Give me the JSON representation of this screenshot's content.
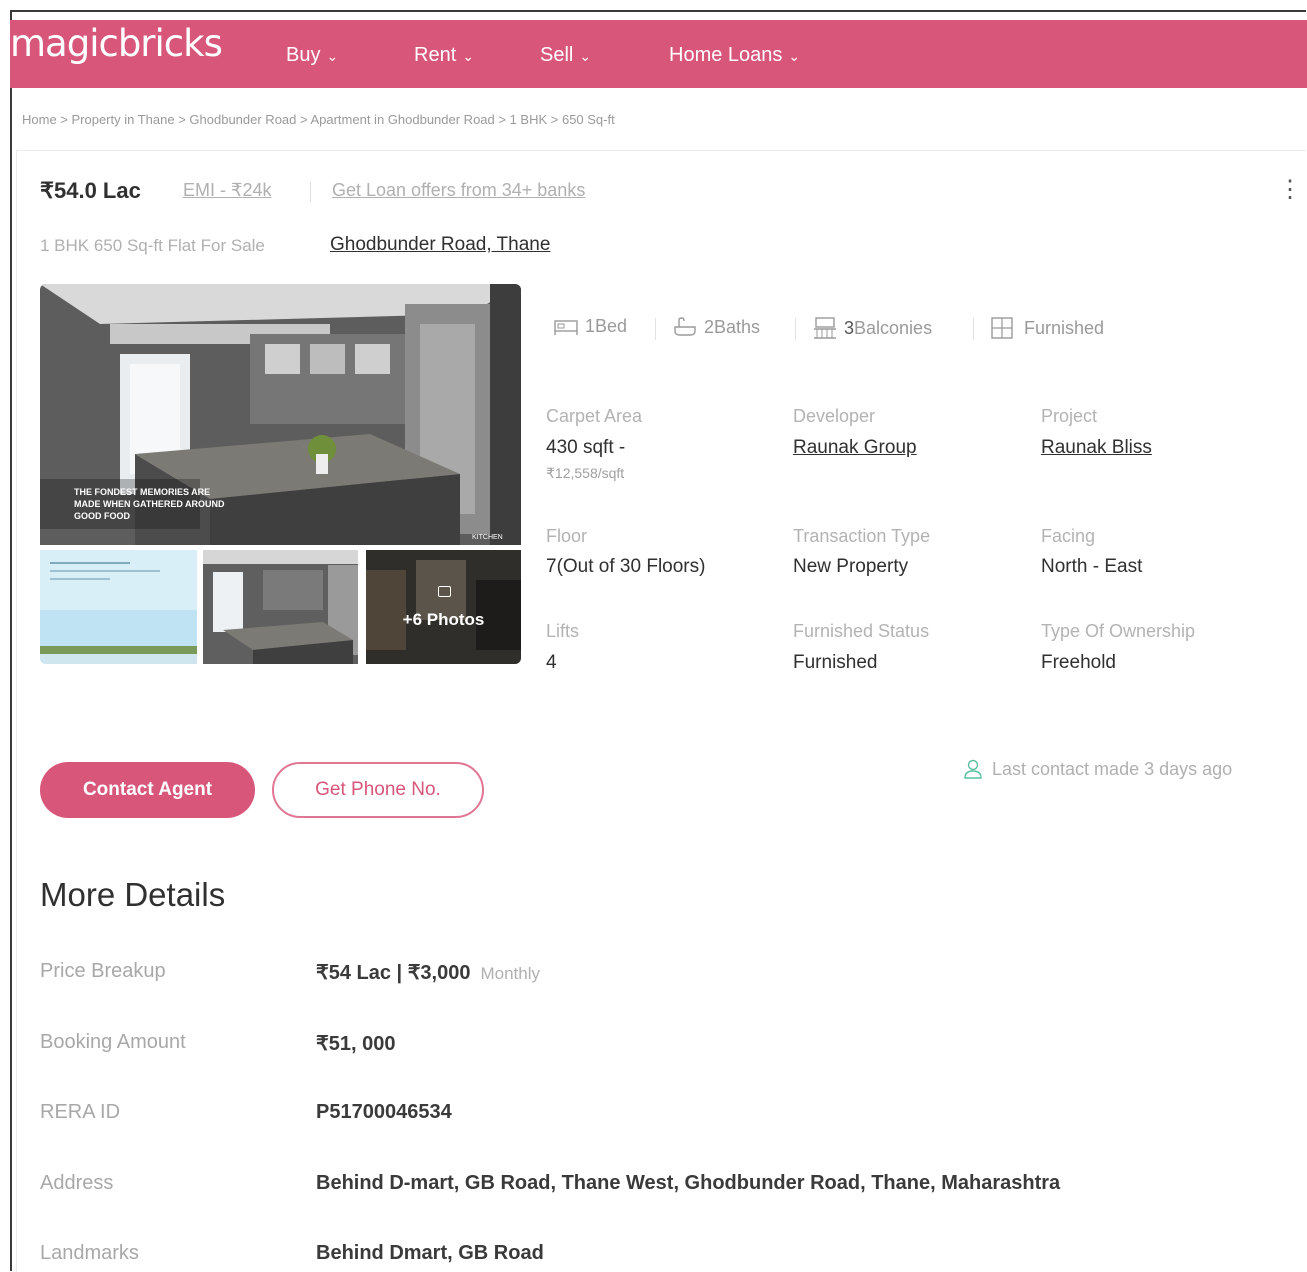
{
  "header": {
    "logo": "magicbricks",
    "nav": [
      {
        "label": "Buy"
      },
      {
        "label": "Rent"
      },
      {
        "label": "Sell"
      },
      {
        "label": "Home Loans"
      }
    ]
  },
  "breadcrumb": "Home > Property in Thane > Ghodbunder Road > Apartment in Ghodbunder Road > 1 BHK > 650 Sq-ft",
  "listing": {
    "price": "₹54.0 Lac",
    "emi": "EMI - ₹24k",
    "loan_offer": "Get Loan offers from 34+ banks",
    "subtitle": "1 BHK 650 Sq-ft Flat For Sale",
    "location": "Ghodbunder Road, Thane",
    "photo_overlay": "THE FONDEST MEMORIES ARE MADE WHEN GATHERED AROUND GOOD FOOD",
    "photo_tag": "KITCHEN",
    "more_photos": "+6 Photos",
    "features": [
      {
        "count": "1",
        "label": "Bed"
      },
      {
        "count": "2",
        "label": "Baths"
      },
      {
        "count": "3",
        "label": "Balconies"
      },
      {
        "count": "",
        "label": "Furnished"
      }
    ],
    "details": {
      "carpet_area": {
        "label": "Carpet Area",
        "value": "430 sqft -",
        "sub": "₹12,558/sqft"
      },
      "developer": {
        "label": "Developer",
        "value": "Raunak Group"
      },
      "project": {
        "label": "Project",
        "value": "Raunak Bliss"
      },
      "floor": {
        "label": "Floor",
        "value": "7(Out of 30 Floors)"
      },
      "transaction": {
        "label": "Transaction Type",
        "value": "New Property"
      },
      "facing": {
        "label": "Facing",
        "value": "North - East"
      },
      "lifts": {
        "label": "Lifts",
        "value": "4"
      },
      "furnished_status": {
        "label": "Furnished Status",
        "value": "Furnished"
      },
      "ownership": {
        "label": "Type Of Ownership",
        "value": "Freehold"
      }
    },
    "actions": {
      "contact_agent": "Contact Agent",
      "get_phone": "Get Phone No.",
      "last_contact": "Last contact made 3 days ago"
    }
  },
  "more_details": {
    "title": "More Details",
    "rows": [
      {
        "label": "Price Breakup",
        "value": "₹54 Lac | ₹3,000",
        "note": "Monthly"
      },
      {
        "label": "Booking Amount",
        "value": "₹51, 000"
      },
      {
        "label": "RERA ID",
        "value": "P51700046534"
      },
      {
        "label": "Address",
        "value": "Behind D-mart, GB Road, Thane West, Ghodbunder Road, Thane, Maharashtra"
      },
      {
        "label": "Landmarks",
        "value": "Behind Dmart, GB Road"
      }
    ]
  },
  "colors": {
    "brand": "#d8567a",
    "text": "#303030",
    "muted": "#b0b0b0"
  }
}
